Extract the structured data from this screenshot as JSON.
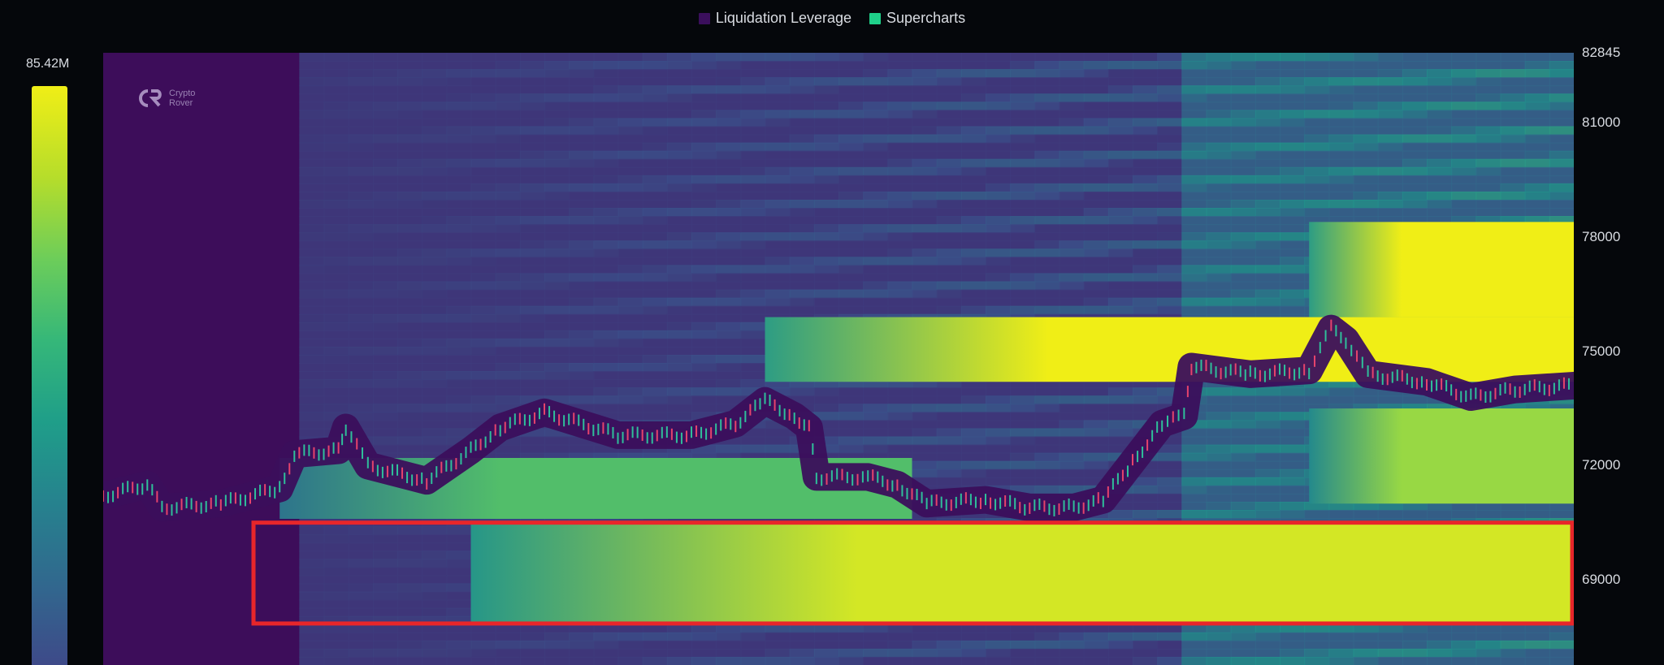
{
  "legend": [
    {
      "label": "Liquidation Leverage",
      "color": "#3b0f5c"
    },
    {
      "label": "Supercharts",
      "color": "#1fd08a"
    }
  ],
  "colorbar": {
    "max_label": "85.42M"
  },
  "logo": {
    "line1": "Crypto",
    "line2": "Rover"
  },
  "colors": {
    "background": "#05070b",
    "highlight_box": "#e8262a",
    "candle_up": "#2fbf9a",
    "candle_down": "#e6436c"
  },
  "chart_data": {
    "type": "heatmap",
    "title": "",
    "xlabel": "",
    "ylabel": "",
    "y_ticks": [
      82845,
      81000,
      78000,
      75000,
      72000,
      69000
    ],
    "ylim": [
      67500,
      82845
    ],
    "colorscale": "viridis",
    "color_max": "85.42M",
    "legend_placement": "top-center",
    "liquidity_bands": [
      {
        "from_x": 0.45,
        "to_x": 1.0,
        "y_low": 74200,
        "y_high": 75900,
        "intensity": 1.0
      },
      {
        "from_x": 0.82,
        "to_x": 1.0,
        "y_low": 75900,
        "y_high": 78400,
        "intensity": 1.0
      },
      {
        "from_x": 0.25,
        "to_x": 1.0,
        "y_low": 67900,
        "y_high": 70500,
        "intensity": 0.95
      },
      {
        "from_x": 0.12,
        "to_x": 0.55,
        "y_low": 70600,
        "y_high": 72200,
        "intensity": 0.7
      },
      {
        "from_x": 0.82,
        "to_x": 1.0,
        "y_low": 71000,
        "y_high": 73500,
        "intensity": 0.85
      }
    ],
    "price_path": [
      {
        "x": 0.0,
        "y": 71200
      },
      {
        "x": 0.03,
        "y": 71500
      },
      {
        "x": 0.04,
        "y": 70900
      },
      {
        "x": 0.08,
        "y": 71000
      },
      {
        "x": 0.12,
        "y": 71400
      },
      {
        "x": 0.13,
        "y": 72300
      },
      {
        "x": 0.16,
        "y": 72400
      },
      {
        "x": 0.165,
        "y": 73000
      },
      {
        "x": 0.18,
        "y": 72000
      },
      {
        "x": 0.22,
        "y": 71600
      },
      {
        "x": 0.25,
        "y": 72400
      },
      {
        "x": 0.27,
        "y": 73000
      },
      {
        "x": 0.3,
        "y": 73400
      },
      {
        "x": 0.35,
        "y": 72800
      },
      {
        "x": 0.4,
        "y": 72800
      },
      {
        "x": 0.43,
        "y": 73100
      },
      {
        "x": 0.45,
        "y": 73700
      },
      {
        "x": 0.47,
        "y": 73300
      },
      {
        "x": 0.48,
        "y": 73000
      },
      {
        "x": 0.485,
        "y": 71700
      },
      {
        "x": 0.52,
        "y": 71700
      },
      {
        "x": 0.54,
        "y": 71500
      },
      {
        "x": 0.56,
        "y": 71000
      },
      {
        "x": 0.6,
        "y": 71100
      },
      {
        "x": 0.63,
        "y": 70900
      },
      {
        "x": 0.66,
        "y": 70900
      },
      {
        "x": 0.68,
        "y": 71100
      },
      {
        "x": 0.7,
        "y": 72100
      },
      {
        "x": 0.72,
        "y": 73100
      },
      {
        "x": 0.735,
        "y": 73300
      },
      {
        "x": 0.74,
        "y": 74600
      },
      {
        "x": 0.78,
        "y": 74400
      },
      {
        "x": 0.82,
        "y": 74500
      },
      {
        "x": 0.835,
        "y": 75600
      },
      {
        "x": 0.845,
        "y": 75300
      },
      {
        "x": 0.86,
        "y": 74400
      },
      {
        "x": 0.9,
        "y": 74200
      },
      {
        "x": 0.93,
        "y": 73800
      },
      {
        "x": 0.96,
        "y": 74000
      },
      {
        "x": 1.0,
        "y": 74100
      }
    ],
    "highlight_range": {
      "x_start": 0.1,
      "x_end": 1.0,
      "y_low": 67850,
      "y_high": 70500
    }
  }
}
